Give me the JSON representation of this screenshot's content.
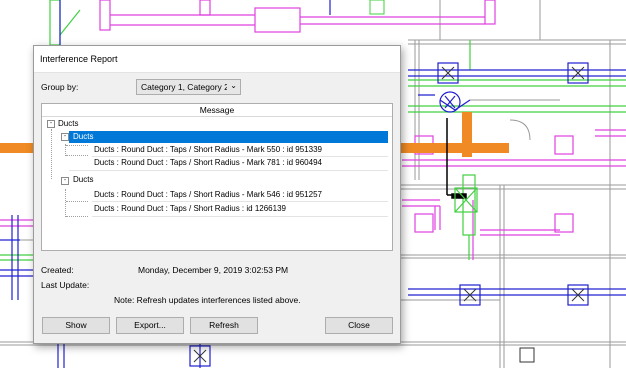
{
  "dialog": {
    "title": "Interference Report",
    "group_by_label": "Group by:",
    "group_by_value": "Category 1, Category 2",
    "column_header": "Message",
    "tree": {
      "root_label": "Ducts",
      "group1_label": "Ducts",
      "group1_items": [
        "Ducts : Round Duct : Taps / Short Radius - Mark 550 : id 951339",
        "Ducts : Round Duct : Taps / Short Radius - Mark 781 : id 960494"
      ],
      "group2_label": "Ducts",
      "group2_items": [
        "Ducts : Round Duct : Taps / Short Radius - Mark 546 : id 951257",
        "Ducts : Round Duct : Taps / Short Radius : id 1266139"
      ]
    },
    "created_label": "Created:",
    "created_value": "Monday, December 9, 2019 3:02:53 PM",
    "last_update_label": "Last Update:",
    "note": "Note: Refresh updates interferences listed above.",
    "buttons": {
      "show": "Show",
      "export": "Export...",
      "refresh": "Refresh",
      "close": "Close"
    }
  },
  "colors": {
    "duct_blue": "#2020d0",
    "duct_magenta": "#e040e0",
    "duct_green": "#40d040",
    "highlight_orange": "#f08a24",
    "selection": "#0078d7"
  },
  "icons": [
    "chevron-down-icon",
    "expand-collapse-icon",
    "air-terminal-icon"
  ]
}
